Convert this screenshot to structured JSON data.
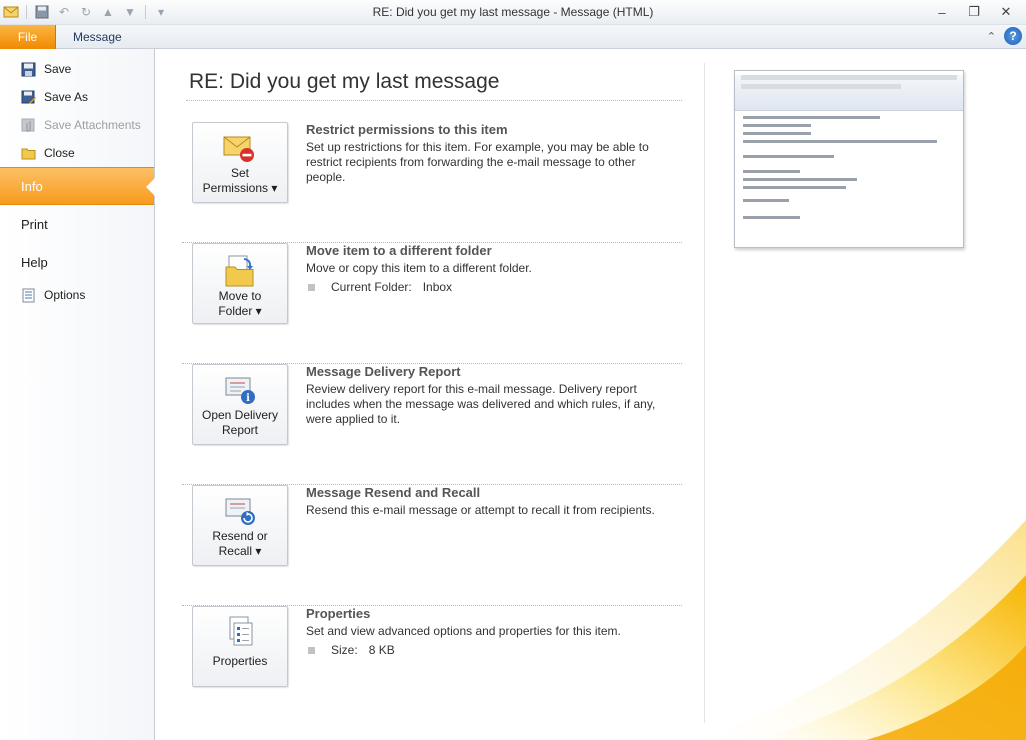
{
  "window": {
    "title": "RE: Did you get my last message  -  Message (HTML)"
  },
  "ribbon": {
    "file_tab": "File",
    "message_tab": "Message"
  },
  "nav": {
    "save": "Save",
    "save_as": "Save As",
    "save_attachments": "Save Attachments",
    "close": "Close",
    "info": "Info",
    "print": "Print",
    "help": "Help",
    "options": "Options"
  },
  "page": {
    "title": "RE: Did you get my last message"
  },
  "sections": [
    {
      "button_line1": "Set",
      "button_line2": "Permissions ▾",
      "title": "Restrict permissions to this item",
      "description": "Set up restrictions for this item. For example, you may be able to restrict recipients from forwarding the e-mail message to other people."
    },
    {
      "button_line1": "Move to",
      "button_line2": "Folder ▾",
      "title": "Move item to a different folder",
      "description": "Move or copy this item to a different folder.",
      "detail_key": "Current Folder:",
      "detail_value": "Inbox"
    },
    {
      "button_line1": "Open Delivery",
      "button_line2": "Report",
      "title": "Message Delivery Report",
      "description": "Review delivery report for this e-mail message. Delivery report includes when the message was delivered and which rules, if any, were applied to it."
    },
    {
      "button_line1": "Resend or",
      "button_line2": "Recall ▾",
      "title": "Message Resend and Recall",
      "description": "Resend this e-mail message or attempt to recall it from recipients."
    },
    {
      "button_line1": "Properties",
      "title": "Properties",
      "description": "Set and view advanced options and properties for this item.",
      "detail_key": "Size:",
      "detail_value": "8 KB"
    }
  ],
  "colors": {
    "accent_orange": "#f79b1e",
    "file_tab": "#f08a00",
    "title_text": "#333333"
  }
}
